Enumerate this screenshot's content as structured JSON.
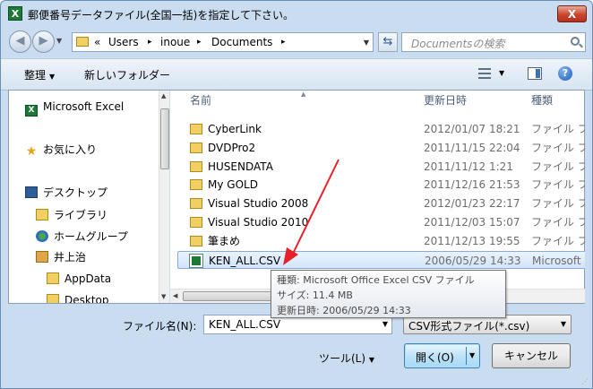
{
  "window": {
    "title": "郵便番号データファイル(全国一括)を指定して下さい。",
    "close_label": "X",
    "app_icon_label": "X"
  },
  "address": {
    "overflow": "«",
    "crumbs": [
      "Users",
      "inoue",
      "Documents"
    ],
    "separator": "▸",
    "search_placeholder": "Documentsの検索"
  },
  "toolbar": {
    "organize": "整理",
    "new_folder": "新しいフォルダー",
    "help": "?"
  },
  "nav": {
    "items": [
      {
        "label": "Microsoft Excel",
        "icon": "excel-icon"
      },
      {
        "label": "お気に入り",
        "icon": "star-icon"
      },
      {
        "label": "デスクトップ",
        "icon": "desktop-icon"
      },
      {
        "label": "ライブラリ",
        "icon": "library-icon"
      },
      {
        "label": "ホームグループ",
        "icon": "homegroup-icon"
      },
      {
        "label": "井上治",
        "icon": "user-folder-icon"
      },
      {
        "label": "AppData",
        "icon": "folder-icon"
      },
      {
        "label": "Desktop",
        "icon": "folder-icon"
      }
    ]
  },
  "columns": {
    "name": "名前",
    "modified": "更新日時",
    "type": "種類"
  },
  "files": [
    {
      "name": "CyberLink",
      "date": "2012/01/07 18:21",
      "type": "ファイル フ"
    },
    {
      "name": "DVDPro2",
      "date": "2011/11/15 22:04",
      "type": "ファイル フ"
    },
    {
      "name": "HUSENDATA",
      "date": "2011/11/12 1:21",
      "type": "ファイル フ"
    },
    {
      "name": "My GOLD",
      "date": "2011/12/16 21:53",
      "type": "ファイル フ"
    },
    {
      "name": "Visual Studio 2008",
      "date": "2012/01/23 22:17",
      "type": "ファイル フ"
    },
    {
      "name": "Visual Studio 2010",
      "date": "2011/12/03 15:07",
      "type": "ファイル フ"
    },
    {
      "name": "筆まめ",
      "date": "2011/12/13 19:55",
      "type": "ファイル フ"
    },
    {
      "name": "KEN_ALL.CSV",
      "date": "2006/05/29 14:33",
      "type": "Microsoft O"
    }
  ],
  "tooltip": {
    "type_line": "種類: Microsoft Office Excel CSV ファイル",
    "size_line": "サイズ: 11.4 MB",
    "date_line": "更新日時: 2006/05/29 14:33"
  },
  "footer": {
    "filename_label": "ファイル名(N):",
    "filename_value": "KEN_ALL.CSV",
    "filter_value": "CSV形式ファイル(*.csv)",
    "tools_label": "ツール(L)",
    "open_label": "開く(O)",
    "cancel_label": "キャンセル"
  },
  "colors": {
    "accent_arrow": "#e8202a",
    "selection": "#d2e5fa"
  }
}
